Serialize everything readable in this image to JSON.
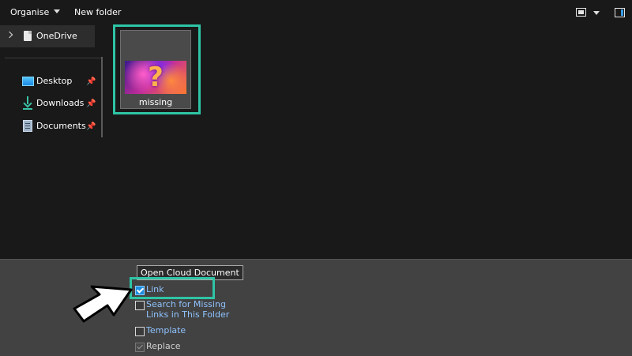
{
  "toolbar": {
    "organise_label": "Organise",
    "new_folder_label": "New folder"
  },
  "sidebar": {
    "items": [
      {
        "label": "OneDrive",
        "icon": "document-icon"
      },
      {
        "label": "Desktop",
        "icon": "desktop-icon",
        "pinned": true
      },
      {
        "label": "Downloads",
        "icon": "download-icon",
        "pinned": true
      },
      {
        "label": "Documents",
        "icon": "documents-icon",
        "pinned": true
      }
    ]
  },
  "main": {
    "files": [
      {
        "name": "missing",
        "thumbnail_glyph": "?"
      }
    ]
  },
  "options": {
    "tooltip": "Open Cloud Document",
    "link_label": "Link",
    "search_label_line1": "Search for Missing",
    "search_label_line2": "Links in This Folder",
    "template_label": "Template",
    "replace_label": "Replace"
  },
  "colors": {
    "highlight": "#2ec4a5",
    "link_text": "#8fc3ff",
    "checkbox_checked": "#1e8fe0",
    "background": "#191919",
    "bottom_panel": "#424242"
  },
  "glyphs": {
    "pin": "📌"
  }
}
